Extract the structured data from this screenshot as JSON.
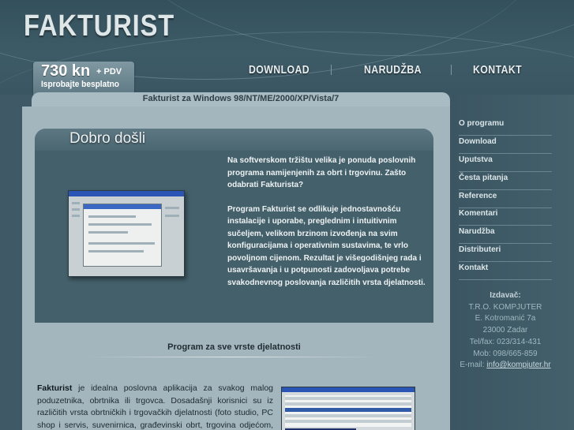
{
  "header": {
    "logo": "FAKTURIST",
    "price": "730 kn",
    "price_suffix": "+ PDV",
    "try_free": "Isprobajte besplatno"
  },
  "nav": {
    "download": "DOWNLOAD",
    "order": "NARUDŽBA",
    "contact": "KONTAKT"
  },
  "page_title": "Fakturist za Windows 98/NT/ME/2000/XP/Vista/7",
  "welcome": {
    "title": "Dobro došli",
    "para1": "Na softverskom tržištu velika je ponuda poslovnih programa namijenjenih za obrt i trgovinu. Zašto odabrati Fakturista?",
    "para2_prefix": "Program ",
    "para2_bold": "Fakturist",
    "para2_rest": " se odlikuje jednostavnošću instalacije i uporabe, preglednim i intuitivnim sučeljem, velikom brzinom izvođenja na svim konfiguracijama i operativnim sustavima, te vrlo povoljnom cijenom. Rezultat je višegodišnjeg rada i usavršavanja i u potpunosti zadovoljava potrebe svakodnevnog poslovanja različitih vrsta djelatnosti."
  },
  "section": {
    "title": "Program za sve vrste djelatnosti",
    "para_bold": "Fakturist",
    "para_rest": " je idealna poslovna aplikacija za svakog malog poduzetnika, obrtnika ili trgovca. Dosadašnji korisnici su iz različitih vrsta obrtničkih i trgovačkih djelatnosti (foto studio, PC shop i servis, suvenirnica, građevinski obrt, trgovina odjećom, stolarija,"
  },
  "sidebar": {
    "items": [
      {
        "label": "O programu"
      },
      {
        "label": "Download"
      },
      {
        "label": "Uputstva"
      },
      {
        "label": "Česta pitanja"
      },
      {
        "label": "Reference"
      },
      {
        "label": "Komentari"
      },
      {
        "label": "Narudžba"
      },
      {
        "label": "Distributeri"
      },
      {
        "label": "Kontakt"
      }
    ]
  },
  "publisher": {
    "title": "Izdavač:",
    "name": "T.R.O. KOMPJUTER",
    "street": "E. Kotromanić 7a",
    "city": "23000 Zadar",
    "telfax": "Tel/fax: 023/314-431",
    "mob": "Mob: 098/665-859",
    "email_label": "E-mail: ",
    "email": "info@kompjuter.hr"
  },
  "colors": {
    "background": "#3f5a66",
    "content": "#a3b6bd",
    "welcome_panel": "#44606b"
  }
}
